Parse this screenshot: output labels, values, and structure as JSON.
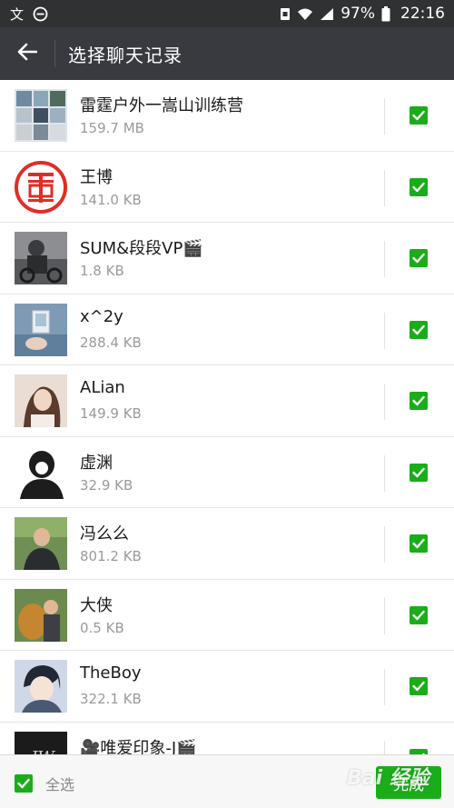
{
  "status_bar": {
    "battery_percent": "97%",
    "time": "22:16",
    "icons": [
      "notification-icon",
      "minus-circle-icon",
      "sim-icon",
      "wifi-icon",
      "signal-icon",
      "battery-icon"
    ]
  },
  "title_bar": {
    "title": "选择聊天记录",
    "back_icon": "arrow-left-icon"
  },
  "chats": [
    {
      "name": "雷霆户外一嵩山训练营",
      "size": "159.7 MB",
      "checked": true,
      "avatar_color": "#6f8aa3"
    },
    {
      "name": "王博",
      "size": "141.0 KB",
      "checked": true,
      "avatar_color": "#e02e26"
    },
    {
      "name": "SUM&段段VP🎬",
      "size": "1.8 KB",
      "checked": true,
      "avatar_color": "#56585c"
    },
    {
      "name": "x^2y",
      "size": "288.4 KB",
      "checked": true,
      "avatar_color": "#6a8eb0"
    },
    {
      "name": "ALian",
      "size": "149.9 KB",
      "checked": true,
      "avatar_color": "#cfb6a6"
    },
    {
      "name": "虚渊",
      "size": "32.9 KB",
      "checked": true,
      "avatar_color": "#1d1d1d"
    },
    {
      "name": "冯么么",
      "size": "801.2 KB",
      "checked": true,
      "avatar_color": "#4a6b3f"
    },
    {
      "name": "大侠",
      "size": "0.5 KB",
      "checked": true,
      "avatar_color": "#b07a3a"
    },
    {
      "name": "TheBoy",
      "size": "322.1 KB",
      "checked": true,
      "avatar_color": "#5f6f8f"
    },
    {
      "name": "🎥唯爱印象-J🎬",
      "size": "",
      "checked": true,
      "avatar_color": "#1b1b1b"
    }
  ],
  "bottom_bar": {
    "select_all_label": "全选",
    "select_all_checked": true,
    "done_label": "完成"
  },
  "watermark": {
    "text": "Bai 经验"
  },
  "colors": {
    "accent": "#1aad19",
    "title_bar": "#393a3f",
    "status_bar": "#2f3133"
  }
}
